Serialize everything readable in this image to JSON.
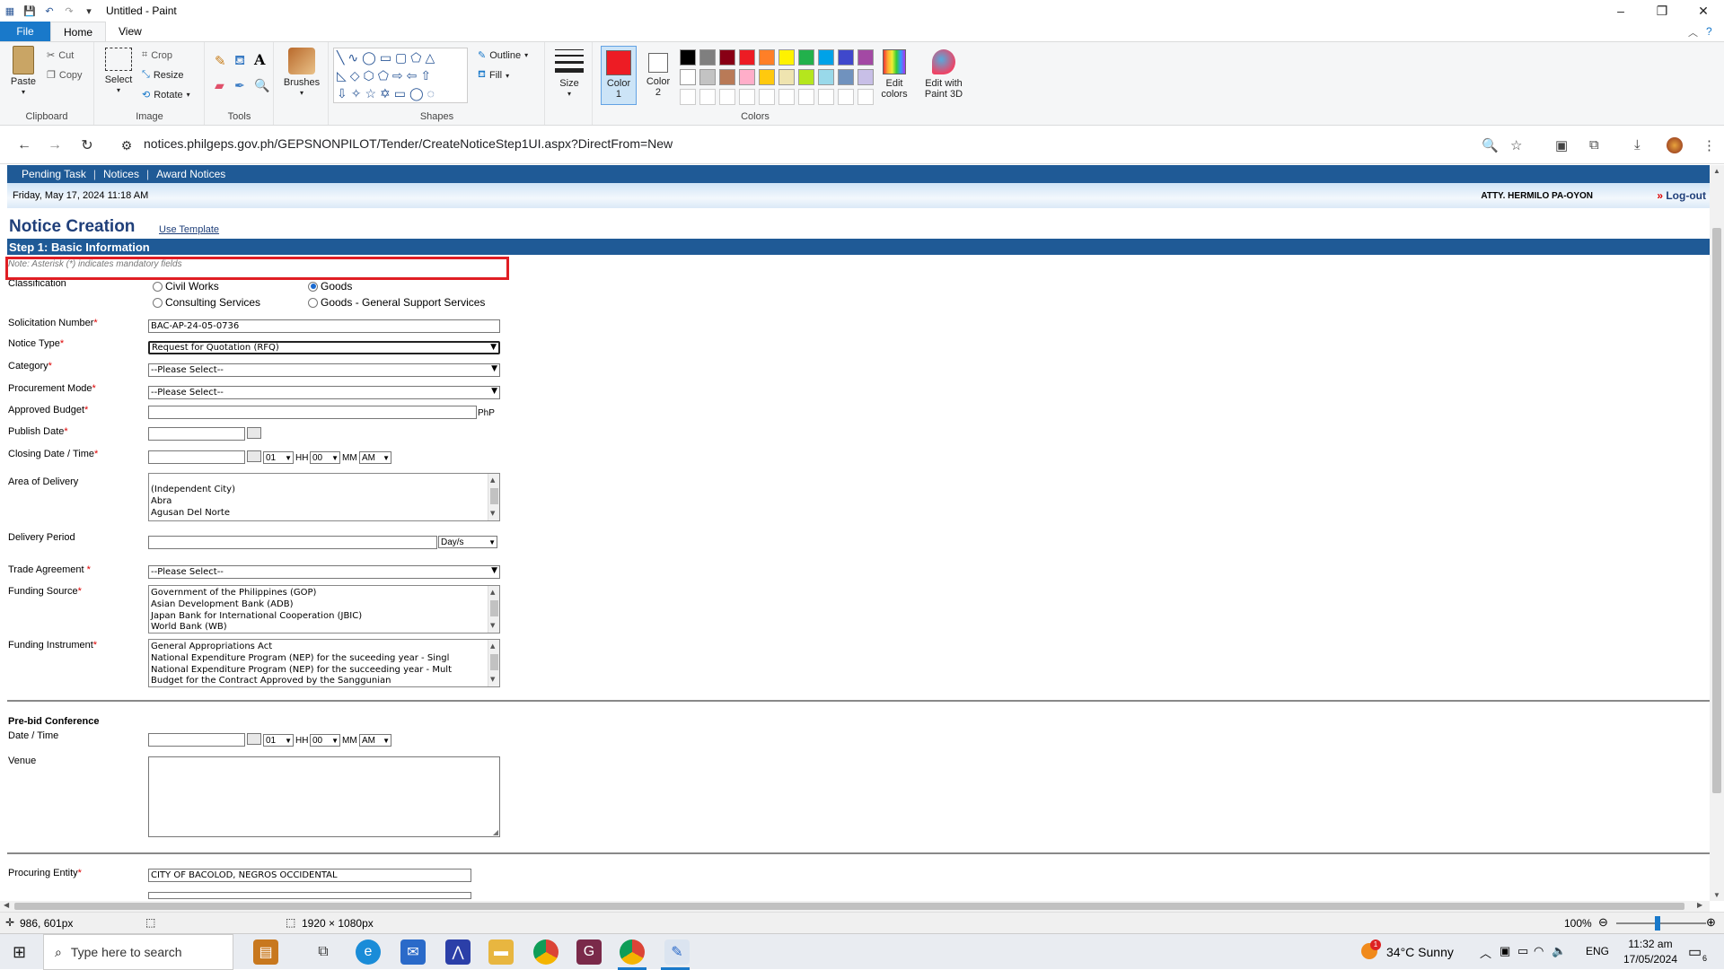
{
  "paint": {
    "title": "Untitled - Paint",
    "tabs": [
      "File",
      "Home",
      "View"
    ],
    "clipboard": {
      "paste": "Paste",
      "cut": "Cut",
      "copy": "Copy",
      "label": "Clipboard"
    },
    "image": {
      "select": "Select",
      "crop": "Crop",
      "resize": "Resize",
      "rotate": "Rotate",
      "label": "Image"
    },
    "tools": {
      "label": "Tools"
    },
    "brushes": "Brushes",
    "shapes": {
      "outline": "Outline",
      "fill": "Fill",
      "label": "Shapes"
    },
    "size": "Size",
    "color1": "Color\n1",
    "color2": "Color\n2",
    "colors_label": "Colors",
    "edit_colors": "Edit\ncolors",
    "edit_paint3d": "Edit with\nPaint 3D",
    "palette_row1": [
      "#000000",
      "#7f7f7f",
      "#880015",
      "#ed1c24",
      "#ff7f27",
      "#fff200",
      "#22b14c",
      "#00a2e8",
      "#3f48cc",
      "#a349a4"
    ],
    "palette_row2": [
      "#ffffff",
      "#c3c3c3",
      "#b97a57",
      "#ffaec9",
      "#ffc90e",
      "#efe4b0",
      "#b5e61d",
      "#99d9ea",
      "#7092be",
      "#c8bfe7"
    ],
    "color1_value": "#ed1c24",
    "status_coords": "986, 601px",
    "status_size": "1920 × 1080px",
    "zoom": "100%"
  },
  "browser": {
    "url": "notices.philgeps.gov.ph/GEPSNONPILOT/Tender/CreateNoticeStep1UI.aspx?DirectFrom=New"
  },
  "site": {
    "nav": [
      "Pending Task",
      "Notices",
      "Award Notices"
    ],
    "date": "Friday, May 17, 2024 11:18 AM",
    "user": "ATTY. HERMILO PA-OYON",
    "logout": "Log-out",
    "logout_prefix": "»",
    "title": "Notice Creation",
    "use_template": "Use Template",
    "step": "Step 1: Basic Information",
    "note": "Note: Asterisk (*) indicates mandatory fields"
  },
  "form": {
    "classification_label": "Classification",
    "classifications": [
      "Civil Works",
      "Goods",
      "Consulting Services",
      "Goods - General Support Services"
    ],
    "solicitation_label": "Solicitation Number",
    "solicitation_value": "BAC-AP-24-05-0736",
    "notice_type_label": "Notice Type",
    "notice_type_value": "Request for Quotation (RFQ)",
    "category_label": "Category",
    "please_select": "--Please Select--",
    "proc_mode_label": "Procurement Mode",
    "budget_label": "Approved Budget",
    "budget_unit": "PhP",
    "publish_label": "Publish Date",
    "closing_label": "Closing Date / Time",
    "hour": "01",
    "hh": "HH",
    "minute": "00",
    "mm": "MM",
    "ampm": "AM",
    "area_label": "Area of Delivery",
    "area_options": [
      "(Independent City)",
      "Abra",
      "Agusan Del Norte"
    ],
    "delivery_label": "Delivery Period",
    "delivery_unit": "Day/s",
    "trade_label": "Trade Agreement",
    "funding_source_label": "Funding Source",
    "funding_sources": [
      "Government of the Philippines (GOP)",
      "Asian Development Bank (ADB)",
      "Japan Bank for International Cooperation (JBIC)",
      "World Bank (WB)"
    ],
    "funding_instrument_label": "Funding Instrument",
    "funding_instruments": [
      "General Appropriations Act",
      "National Expenditure Program (NEP) for the suceeding year - Singl",
      "National Expenditure Program (NEP) for the succeeding year - Mult",
      "Budget for the Contract Approved by the Sanggunian"
    ],
    "prebid_heading": "Pre-bid Conference",
    "datetime_label": "Date / Time",
    "venue_label": "Venue",
    "procuring_label": "Procuring Entity",
    "procuring_value": "CITY OF BACOLOD, NEGROS OCCIDENTAL",
    "asterisk": "*"
  },
  "taskbar": {
    "search_placeholder": "Type here to search",
    "weather": "34°C  Sunny",
    "lang": "ENG",
    "time": "11:32 am",
    "date": "17/05/2024",
    "notif_count": "6",
    "weather_badge": "1"
  }
}
